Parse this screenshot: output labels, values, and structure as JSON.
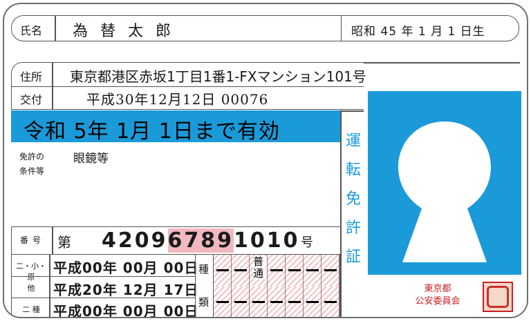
{
  "name": {
    "label": "氏名",
    "value": "為替太郎"
  },
  "birth": {
    "value": "昭和 45 年 1 月 1 日生"
  },
  "address": {
    "label": "住所",
    "value": "東京都港区赤坂1丁目1番1-FXマンション101号"
  },
  "issue": {
    "label": "交付",
    "value": "平成30年12月12日 00076"
  },
  "expiry": {
    "value": "令和 5年 1月 1日まで有効",
    "band_color": "#1a9ad8"
  },
  "conditions": {
    "label_line1": "免許の",
    "label_line2": "条件等",
    "value": "眼鏡等"
  },
  "number": {
    "label": "番号",
    "prefix": "第",
    "digits_a": "4209",
    "digits_b": "6789",
    "digits_c": "1010",
    "suffix": "号",
    "highlight_color": "#f2b8c0"
  },
  "license_dates": [
    {
      "label": "二・小・原",
      "value": "平成00年 00月 00日"
    },
    {
      "label": "他",
      "value": "平成20年 12月 17日"
    },
    {
      "label": "二 種",
      "value": "平成00年 00月 00日"
    }
  ],
  "type_grid": {
    "head_top": "種",
    "head_bottom": "類",
    "cell_label": "普通"
  },
  "card_title": [
    "運",
    "転",
    "免",
    "許",
    "証"
  ],
  "issuer": {
    "line1": "東京都",
    "line2": "公安委員会",
    "color": "#c81e1e"
  },
  "accent_color": "#1a9ad8",
  "photo_placeholder_icon": "person-silhouette-icon",
  "seal_icon": "official-seal-icon"
}
